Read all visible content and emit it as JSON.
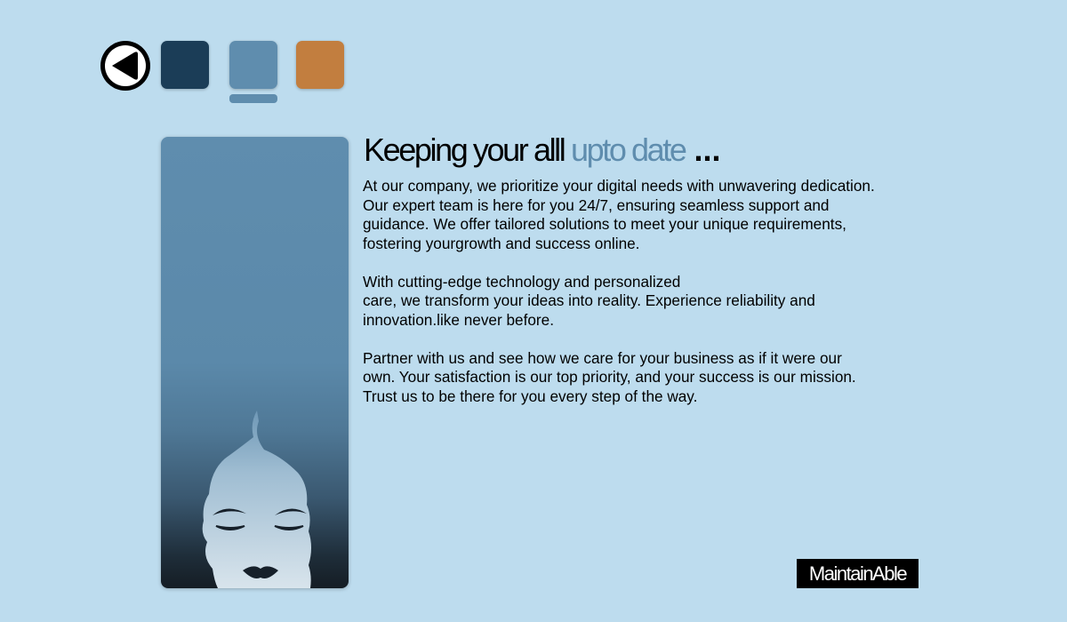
{
  "colors": {
    "background": "#bddcee",
    "swatch_dark_navy": "#1b3d57",
    "swatch_steel_blue": "#5f8dae",
    "swatch_orange": "#c27e3f",
    "accent": "#5f8dae",
    "text": "#000000"
  },
  "nav": {
    "back_icon": "back-arrow-icon",
    "swatches": [
      {
        "name": "dark-navy",
        "color": "#1b3d57",
        "selected": false
      },
      {
        "name": "steel-blue",
        "color": "#5f8dae",
        "selected": true
      },
      {
        "name": "orange",
        "color": "#c27e3f",
        "selected": false
      }
    ]
  },
  "headline": {
    "part1": "Keeping your alll ",
    "accent": "upto date",
    "ellipsis": " ..."
  },
  "paragraphs": [
    "At our company, we prioritize your digital needs with unwavering dedication.\nOur expert team is here for you 24/7, ensuring seamless support and\nguidance. We offer tailored solutions to meet your unique requirements,\nfostering yourgrowth and success online.",
    "With cutting-edge technology and personalized\ncare, we transform your ideas into reality. Experience reliability and\ninnovation.like never before.",
    "Partner with us and see how we care for your business as if it were our\nown. Your satisfaction is our top priority, and your success is our mission.\nTrust us to be there for you every step of the way."
  ],
  "logo": {
    "text": "MaintainAble"
  },
  "image": {
    "subject": "woman-face-illustration"
  }
}
